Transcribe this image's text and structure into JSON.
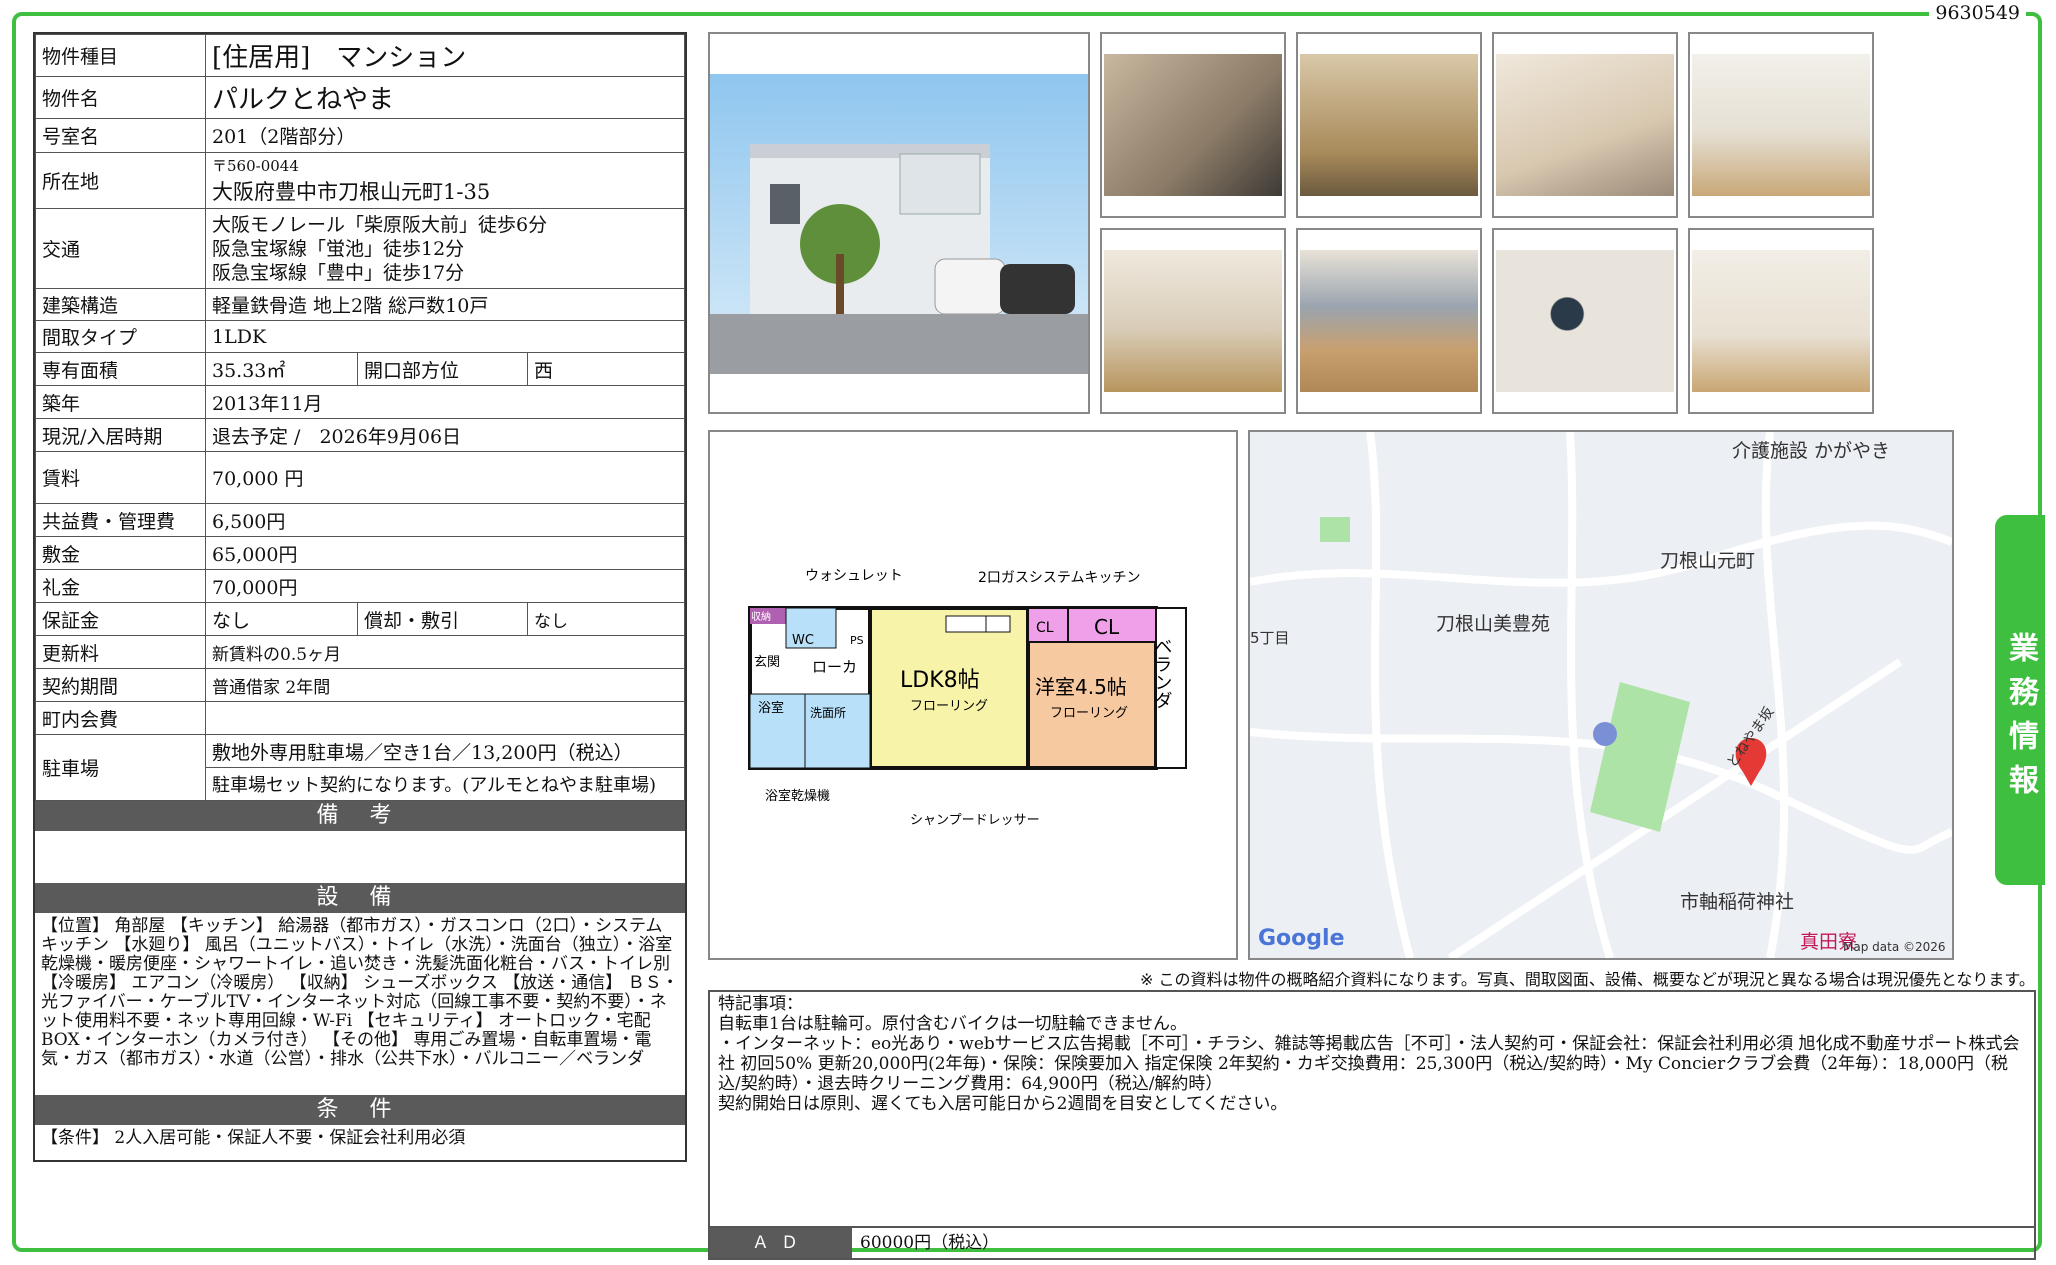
{
  "doc_id": "9630549",
  "side_tab": "業務情報",
  "info": {
    "type_label": "物件種目",
    "type_value": "[住居用]　マンション",
    "name_label": "物件名",
    "name_value": "パルクとねやま",
    "room_label": "号室名",
    "room_value": "201（2階部分）",
    "address_label": "所在地",
    "postal": "〒560-0044",
    "address": "大阪府豊中市刀根山元町1-35",
    "transport_label": "交通",
    "transport": [
      "大阪モノレール「柴原阪大前」徒歩6分",
      "阪急宝塚線「蛍池」徒歩12分",
      "阪急宝塚線「豊中」徒歩17分"
    ],
    "structure_label": "建築構造",
    "structure_value": "軽量鉄骨造 地上2階 総戸数10戸",
    "layout_label": "間取タイプ",
    "layout_value": "1LDK",
    "area_label": "専有面積",
    "area_value": "35.33㎡",
    "direction_label": "開口部方位",
    "direction_value": "西",
    "built_label": "築年",
    "built_value": "2013年11月",
    "status_label": "現況/入居時期",
    "status_value": "退去予定 /　2026年9月06日",
    "rent_label": "賃料",
    "rent_value": "70,000 円",
    "fee_label": "共益費・管理費",
    "fee_value": "6,500円",
    "deposit_label": "敷金",
    "deposit_value": "65,000円",
    "key_money_label": "礼金",
    "key_money_value": "70,000円",
    "guarantee_label": "保証金",
    "guarantee_value": "なし",
    "amort_label": "償却・敷引",
    "amort_value": "なし",
    "renewal_label": "更新料",
    "renewal_value": "新賃料の0.5ヶ月",
    "contract_label": "契約期間",
    "contract_value": "普通借家 2年間",
    "town_label": "町内会費",
    "town_value": "",
    "parking_label": "駐車場",
    "parking_value1": "敷地外専用駐車場／空き1台／13,200円（税込）",
    "parking_value2": "駐車場セット契約になります。(アルモとねやま駐車場)"
  },
  "sections": {
    "biko_title": "備 考",
    "biko_text": "",
    "setsubi_title": "設 備",
    "setsubi_text": "【位置】 角部屋 【キッチン】 給湯器（都市ガス）・ガスコンロ（2口）・システムキッチン 【水廻り】 風呂（ユニットバス）・トイレ（水洗）・洗面台（独立）・浴室乾燥機・暖房便座・シャワートイレ・追い焚き・洗髪洗面化粧台・バス・トイレ別 【冷暖房】 エアコン（冷暖房） 【収納】 シューズボックス 【放送・通信】 ＢＳ・光ファイバー・ケーブルTV・インターネット対応（回線工事不要・契約不要）・ネット使用料不要・ネット専用回線・W-Fi 【セキュリティ】 オートロック・宅配BOX・インターホン（カメラ付き） 【その他】 専用ごみ置場・自転車置場・電気・ガス（都市ガス）・水道（公営）・排水（公共下水）・バルコニー／ベランダ",
    "joken_title": "条 件",
    "joken_text": "【条件】 2人入居可能・保証人不要・保証会社利用必須"
  },
  "floorplan": {
    "washlet": "ウォシュレット",
    "kitchen": "2口ガスシステムキッチン",
    "storage": "収納",
    "wc": "WC",
    "ps": "PS",
    "entrance": "玄関",
    "hall": "ローカ",
    "ldk": "LDK8帖",
    "ldk_floor": "フローリング",
    "western": "洋室4.5帖",
    "western_floor": "フローリング",
    "cl1": "CL",
    "cl2": "CL",
    "veranda": "ベランダ",
    "bath": "浴室",
    "washroom": "洗面所",
    "dryer": "浴室乾燥機",
    "dresser": "シャンプードレッサー"
  },
  "map": {
    "labels": [
      "介護施設 かがやき",
      "刀根山元町",
      "刀根山美豊苑",
      "とねやま坂",
      "市軸稲荷神社",
      "真田寮",
      "5丁目"
    ],
    "google": "Google",
    "mapdata": "Map data ©2026"
  },
  "note": "※ この資料は物件の概略紹介資料になります。写真、間取図面、設備、概要などが現況と異なる場合は現況優先となります。",
  "remarks": {
    "lines": [
      "特記事項：",
      "自転車1台は駐輪可。原付含むバイクは一切駐輪できません。",
      "・インターネット：eo光あり・webサービス広告掲載［不可］・チラシ、雑誌等掲載広告［不可］・法人契約可・保証会社：保証会社利用必須 旭化成不動産サポート株式会社 初回50% 更新20,000円(2年毎)・保険：保険要加入 指定保険 2年契約・カギ交換費用：25,300円（税込/契約時）・My Concierクラブ会費（2年毎）：18,000円（税込/契約時）・退去時クリーニング費用：64,900円（税込/解約時）",
      "契約開始日は原則、遅くても入居可能日から2週間を目安としてください。"
    ],
    "ad_label": "ＡＤ",
    "ad_value": "60000円（税込）"
  }
}
